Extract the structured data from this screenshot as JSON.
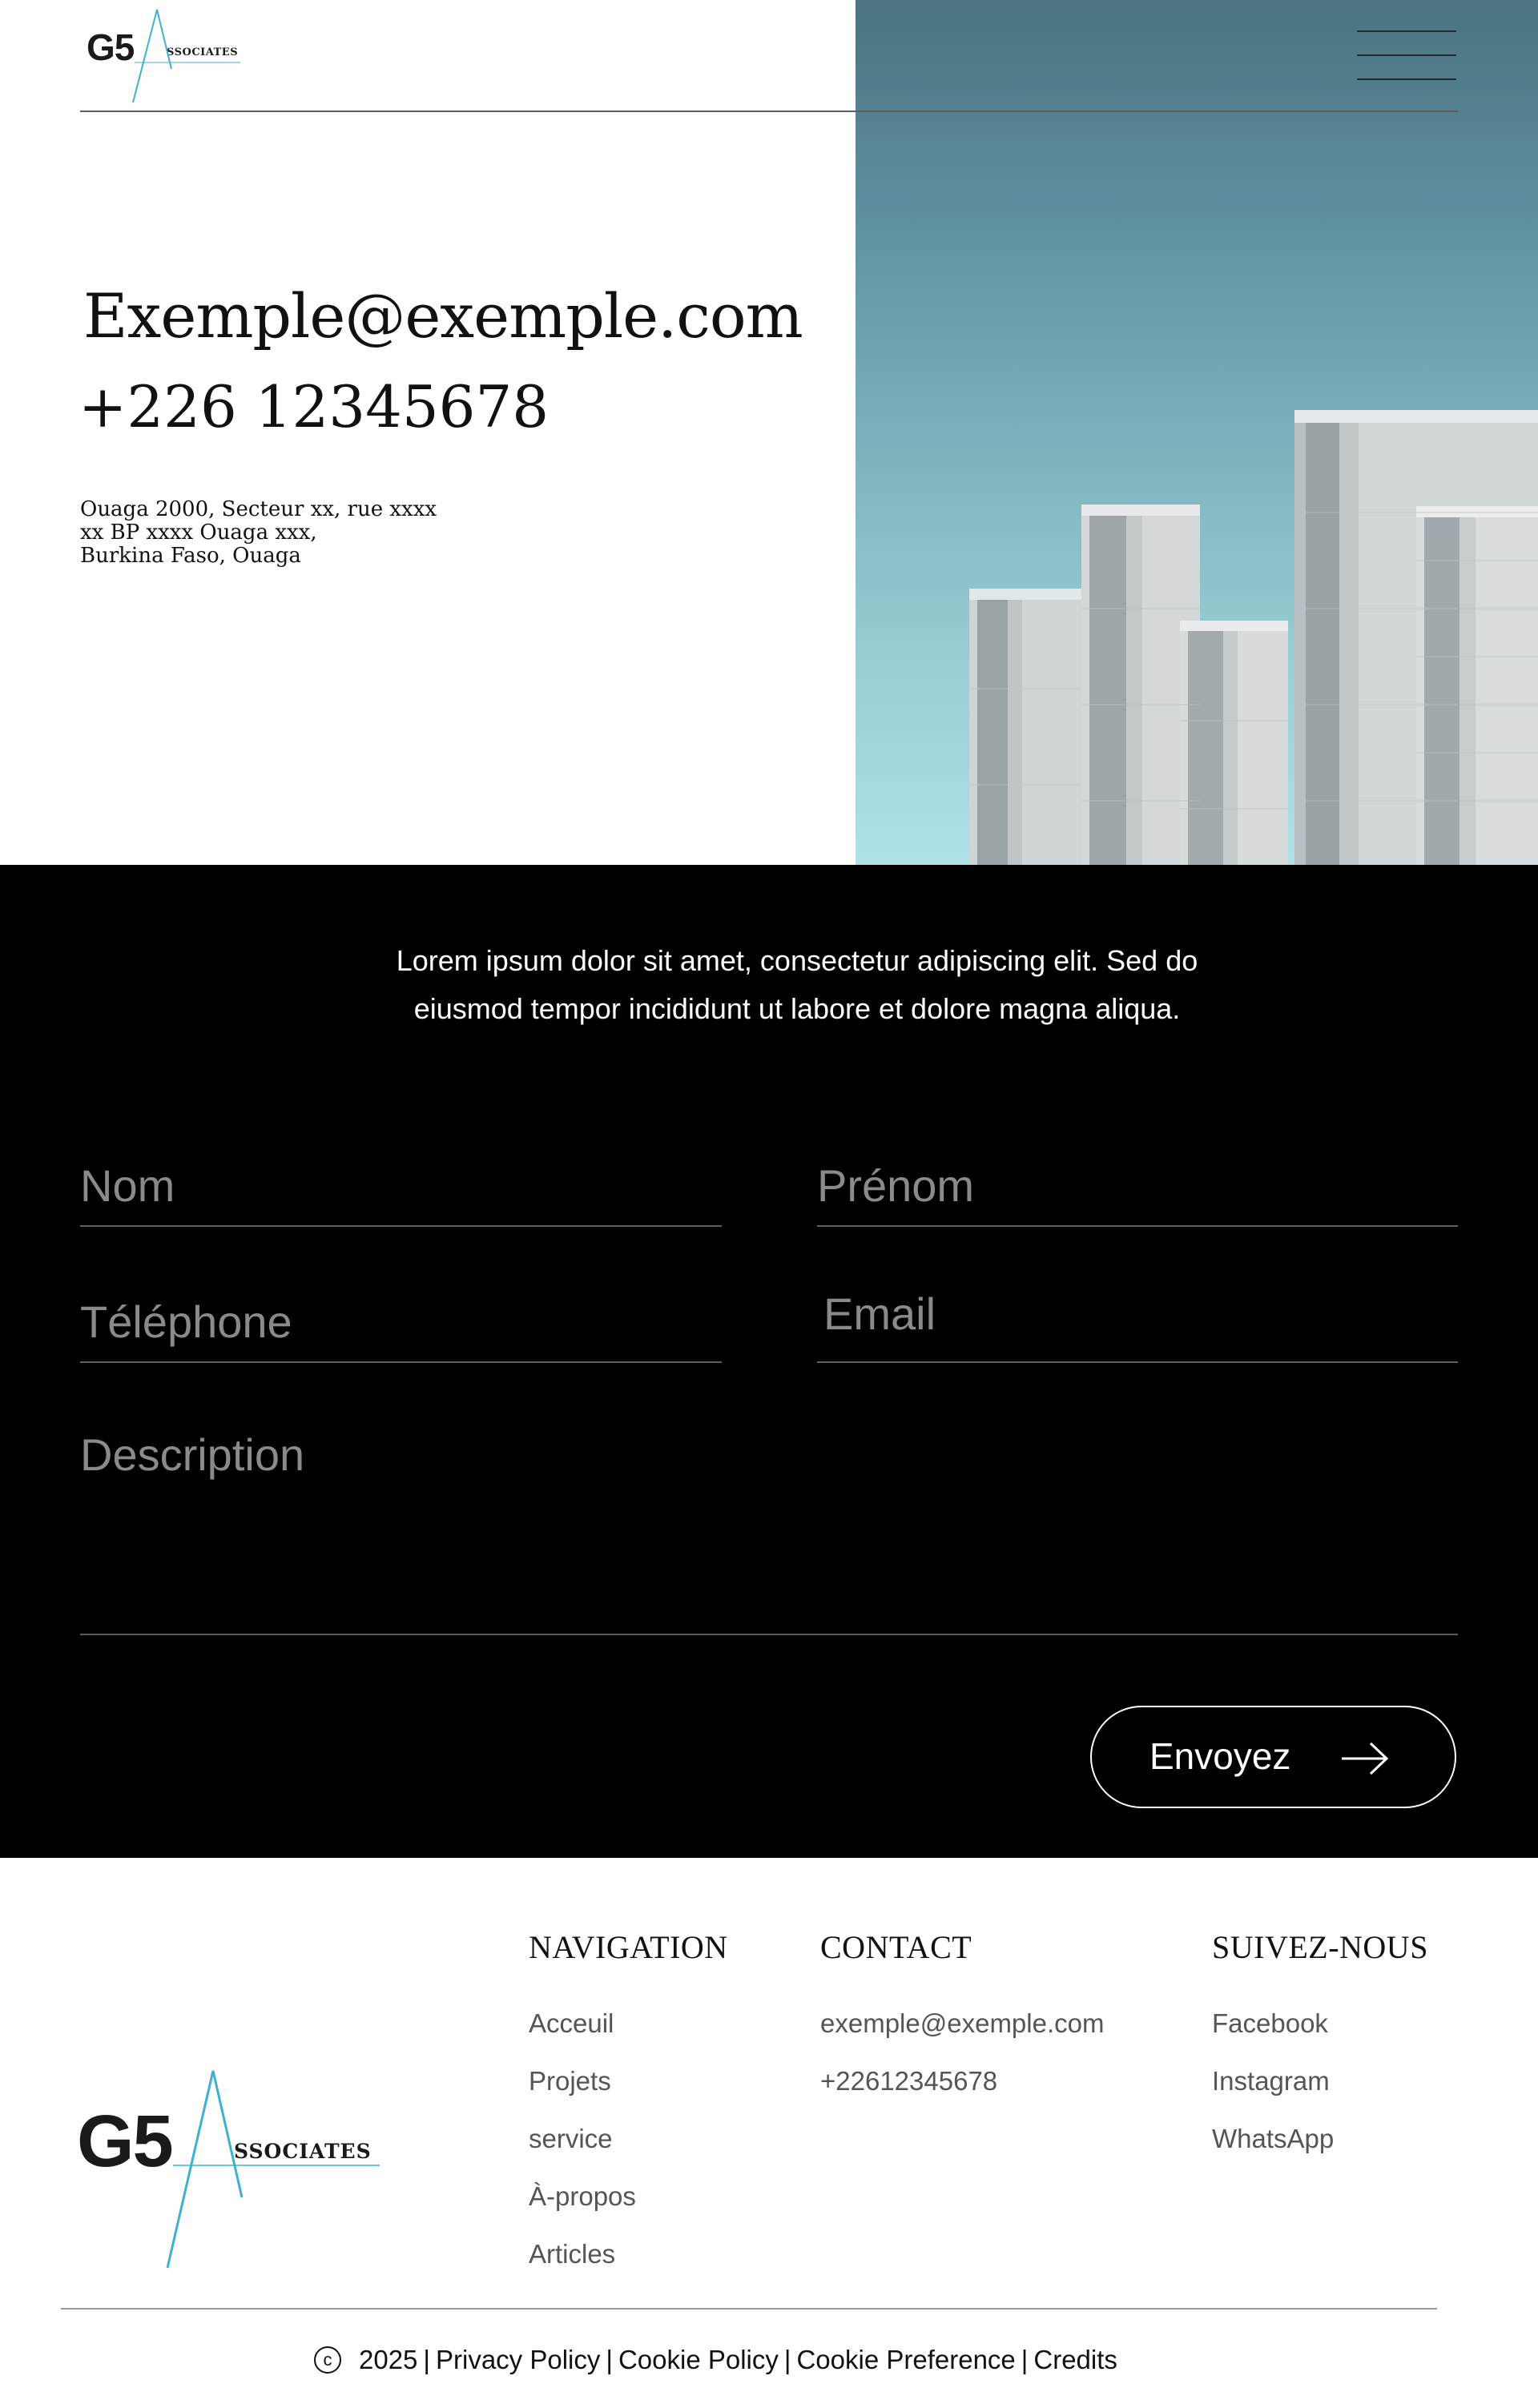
{
  "header": {
    "logo_text": "G5",
    "logo_subtext": "SSOCIATES",
    "menu_icon": "hamburger-menu-icon"
  },
  "hero": {
    "email": "Exemple@exemple.com",
    "phone": "+226 12345678",
    "address_lines": [
      "Ouaga 2000, Secteur xx, rue xxxx",
      "xx BP xxxx Ouaga xxx,",
      "Burkina Faso, Ouaga"
    ],
    "image": "building-photo"
  },
  "form": {
    "intro": "Lorem ipsum dolor sit amet, consectetur adipiscing elit. Sed do eiusmod tempor incididunt ut labore et dolore magna aliqua.",
    "fields": {
      "nom": {
        "placeholder": "Nom",
        "value": ""
      },
      "prenom": {
        "placeholder": "Prénom",
        "value": ""
      },
      "telephone": {
        "placeholder": "Téléphone",
        "value": ""
      },
      "email": {
        "placeholder": "Email",
        "value": ""
      },
      "description": {
        "placeholder": "Description",
        "value": ""
      }
    },
    "submit_label": "Envoyez",
    "submit_icon": "arrow-right-icon"
  },
  "footer": {
    "logo_text": "G5",
    "logo_subtext": "SSOCIATES",
    "navigation": {
      "title": "NAVIGATION",
      "items": [
        "Acceuil",
        "Projets",
        "service",
        "À-propos",
        "Articles"
      ]
    },
    "contact": {
      "title": "CONTACT",
      "items": [
        "exemple@exemple.com",
        "+22612345678"
      ]
    },
    "social": {
      "title": "SUIVEZ-NOUS",
      "items": [
        "Facebook",
        "Instagram",
        "WhatsApp"
      ]
    },
    "legal": {
      "copyright_symbol": "c",
      "year": "2025",
      "links": [
        "Privacy Policy",
        "Cookie Policy",
        "Cookie Preference",
        "Credits"
      ],
      "separator": "|"
    }
  },
  "colors": {
    "accent": "#3fb0d0",
    "form_background": "#000000",
    "sky_top": "#4b7381",
    "sky_bottom": "#aee2e7"
  }
}
